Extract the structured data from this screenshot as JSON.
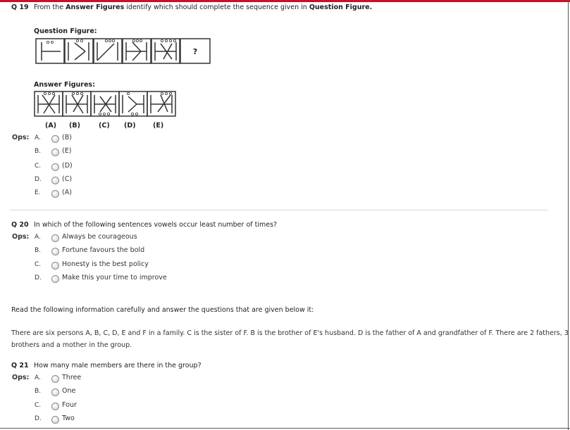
{
  "q19": {
    "number": "Q 19",
    "text_parts": [
      "From the ",
      "Answer Figures",
      " identify which should complete the sequence given in ",
      "Question Figure."
    ],
    "question_figure_label": "Question Figure:",
    "question_mark": "?",
    "answer_figures_label": "Answer Figures:",
    "answer_labels": [
      "(A)",
      "(B)",
      "(C)",
      "(D)",
      "(E)"
    ],
    "ops_label": "Ops:",
    "options": [
      {
        "letter": "A.",
        "text": "(B)"
      },
      {
        "letter": "B.",
        "text": "(E)"
      },
      {
        "letter": "C.",
        "text": "(D)"
      },
      {
        "letter": "D.",
        "text": "(C)"
      },
      {
        "letter": "E.",
        "text": "(A)"
      }
    ]
  },
  "q20": {
    "number": "Q 20",
    "text": "In which of the following sentences vowels occur least number of times?",
    "ops_label": "Ops:",
    "options": [
      {
        "letter": "A.",
        "text": "Always be courageous"
      },
      {
        "letter": "B.",
        "text": "Fortune favours the bold"
      },
      {
        "letter": "C.",
        "text": "Honesty is the best policy"
      },
      {
        "letter": "D.",
        "text": "Make this your time to improve"
      }
    ]
  },
  "instructions": "Read the following information carefully and answer the questions that are given below it:",
  "passage_line1": "There are six persons A, B, C, D, E and F in a family. C is the sister of F. B is the brother of E's husband. D is the father of A and grandfather of F. There are 2 fathers, 3",
  "passage_line2": "brothers and a mother in the group.",
  "q21": {
    "number": "Q 21",
    "text": "How many male members are there in the group?",
    "ops_label": "Ops:",
    "options": [
      {
        "letter": "A.",
        "text": "Three"
      },
      {
        "letter": "B.",
        "text": "One"
      },
      {
        "letter": "C.",
        "text": "Four"
      },
      {
        "letter": "D.",
        "text": "Two"
      }
    ]
  }
}
